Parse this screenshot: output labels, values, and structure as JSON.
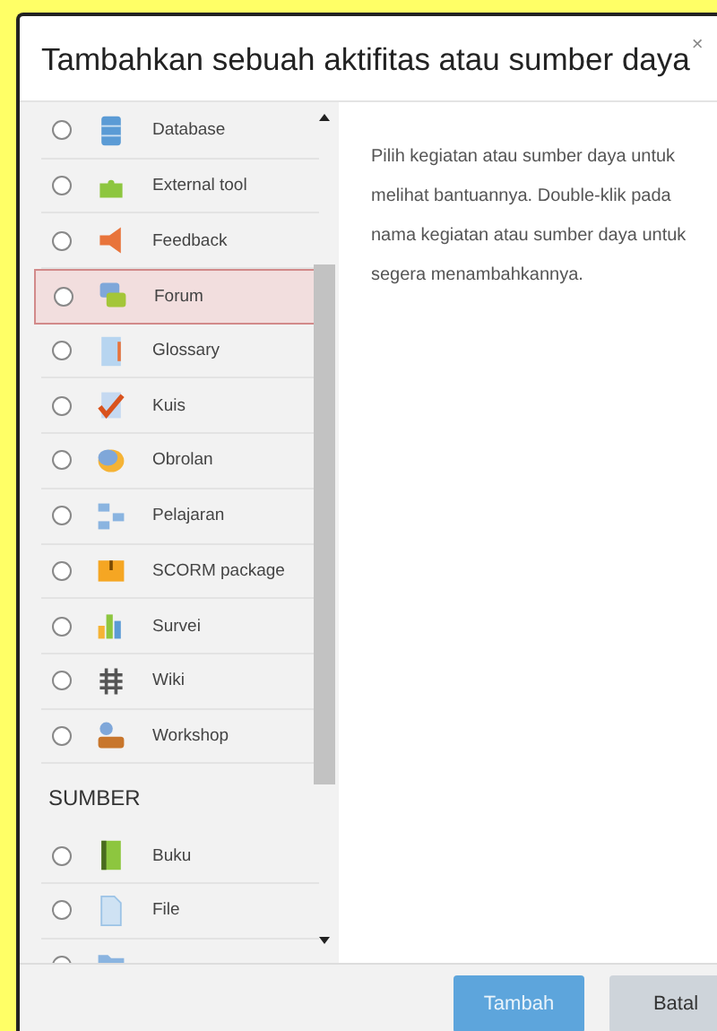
{
  "dialog": {
    "title": "Tambahkan sebuah aktifitas atau sumber daya",
    "close": "×"
  },
  "activities": [
    {
      "label": "Database",
      "selected": false
    },
    {
      "label": "External tool",
      "selected": false
    },
    {
      "label": "Feedback",
      "selected": false
    },
    {
      "label": "Forum",
      "selected": true
    },
    {
      "label": "Glossary",
      "selected": false
    },
    {
      "label": "Kuis",
      "selected": false
    },
    {
      "label": "Obrolan",
      "selected": false
    },
    {
      "label": "Pelajaran",
      "selected": false
    },
    {
      "label": "SCORM package",
      "selected": false
    },
    {
      "label": "Survei",
      "selected": false
    },
    {
      "label": "Wiki",
      "selected": false
    },
    {
      "label": "Workshop",
      "selected": false
    }
  ],
  "resources_heading": "SUMBER",
  "resources": [
    {
      "label": "Buku",
      "selected": false
    },
    {
      "label": "File",
      "selected": false
    },
    {
      "selected": false
    }
  ],
  "help": "Pilih kegiatan atau sumber daya untuk melihat bantuannya. Double-klik pada nama kegiatan atau sumber daya untuk segera menambahkannya.",
  "buttons": [
    {
      "label": "Tambah",
      "kind": "primary"
    },
    {
      "label": "Batal",
      "kind": "secondary"
    }
  ]
}
